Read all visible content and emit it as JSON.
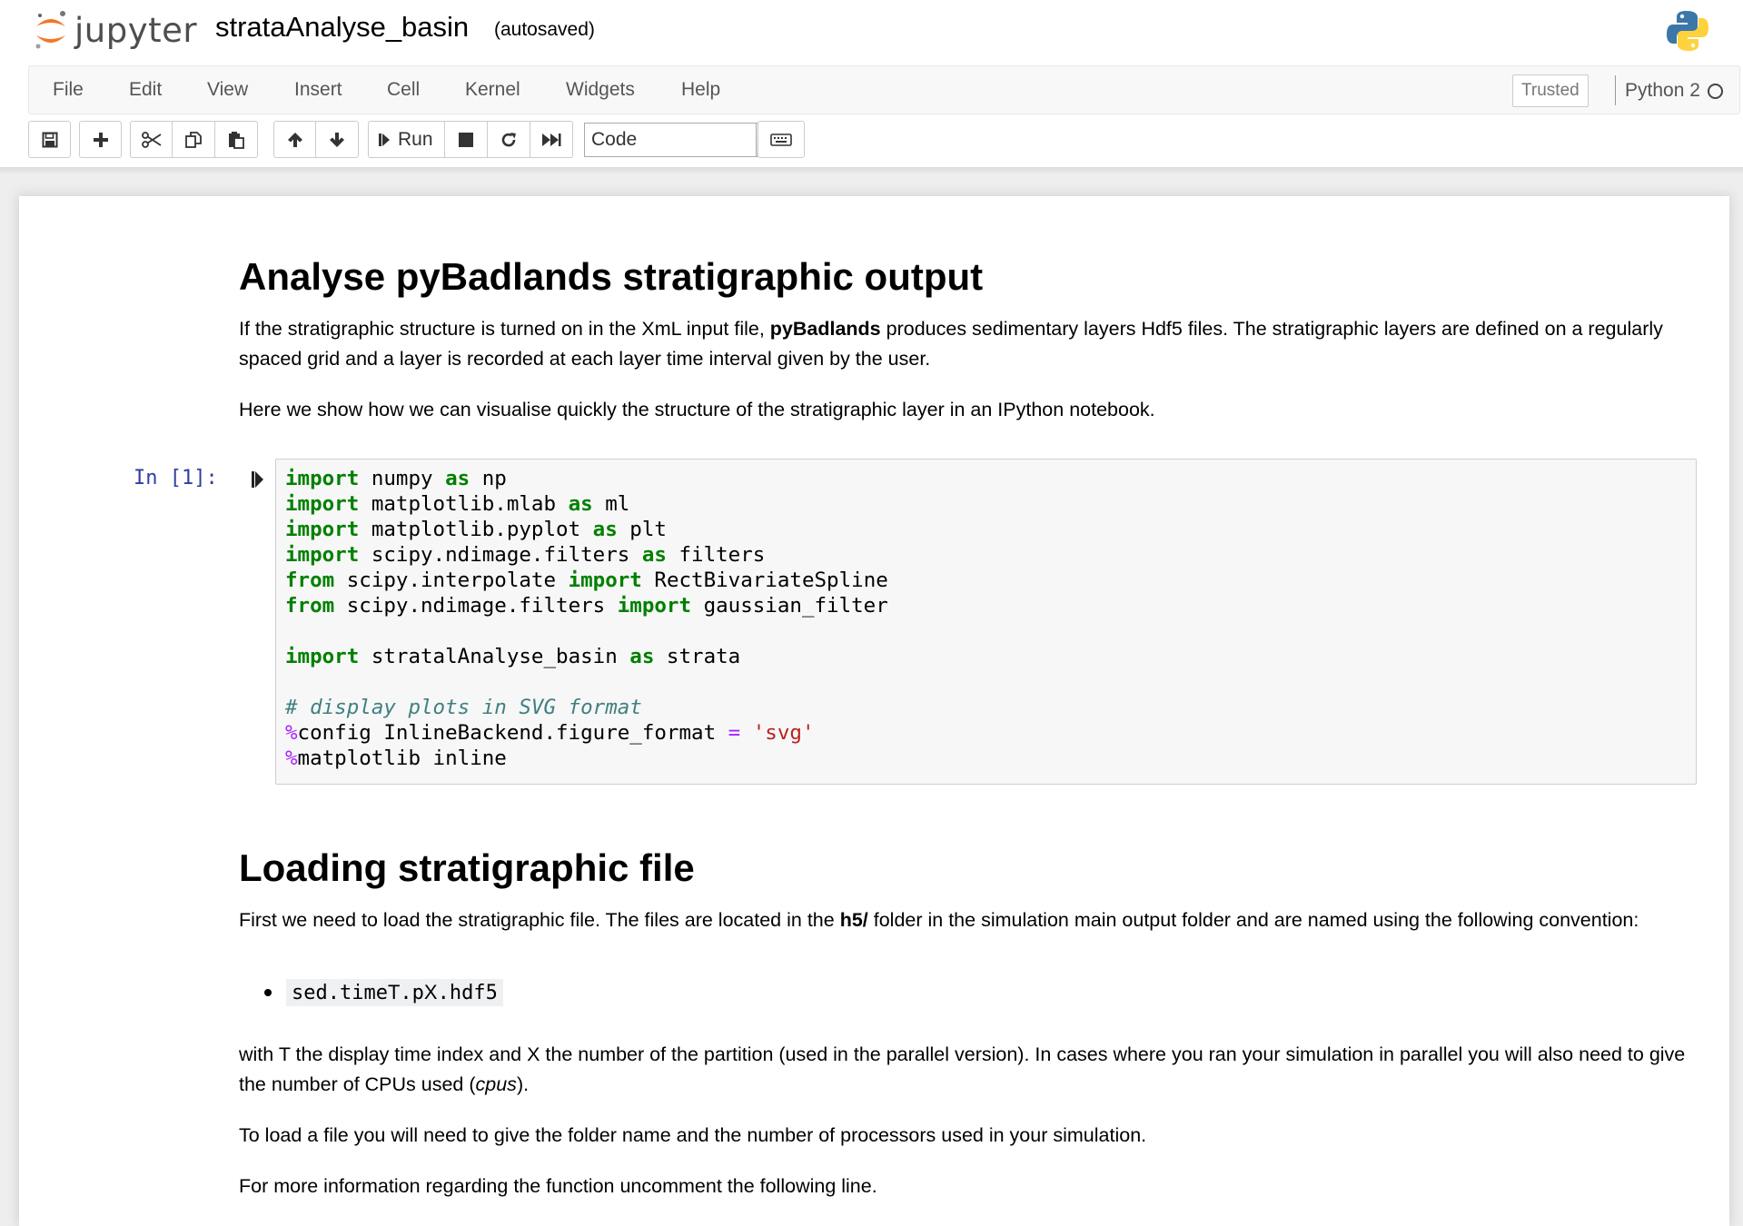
{
  "header": {
    "logo_text": "jupyter",
    "notebook_name": "strataAnalyse_basin",
    "save_status": "(autosaved)"
  },
  "menu": {
    "items": [
      "File",
      "Edit",
      "View",
      "Insert",
      "Cell",
      "Kernel",
      "Widgets",
      "Help"
    ],
    "trusted": "Trusted",
    "kernel": "Python 2"
  },
  "toolbar": {
    "run_label": "Run",
    "cell_type": "Code"
  },
  "cells": {
    "md1": {
      "heading": "Analyse pyBadlands stratigraphic output",
      "p1_before": "If the stratigraphic structure is turned on in the XmL input file, ",
      "p1_bold": "pyBadlands",
      "p1_after": " produces sedimentary layers Hdf5 files. The stratigraphic layers are defined on a regularly spaced grid and a layer is recorded at each layer time interval given by the user.",
      "p2": "Here we show how we can visualise quickly the structure of the stratigraphic layer in an IPython notebook."
    },
    "code1": {
      "prompt": "In [1]:",
      "lines": [
        [
          [
            "kw",
            "import"
          ],
          [
            "",
            " numpy "
          ],
          [
            "kw",
            "as"
          ],
          [
            "",
            " np"
          ]
        ],
        [
          [
            "kw",
            "import"
          ],
          [
            "",
            " matplotlib.mlab "
          ],
          [
            "kw",
            "as"
          ],
          [
            "",
            " ml"
          ]
        ],
        [
          [
            "kw",
            "import"
          ],
          [
            "",
            " matplotlib.pyplot "
          ],
          [
            "kw",
            "as"
          ],
          [
            "",
            " plt"
          ]
        ],
        [
          [
            "kw",
            "import"
          ],
          [
            "",
            " scipy.ndimage.filters "
          ],
          [
            "kw",
            "as"
          ],
          [
            "",
            " filters"
          ]
        ],
        [
          [
            "kw",
            "from"
          ],
          [
            "",
            " scipy.interpolate "
          ],
          [
            "kw",
            "import"
          ],
          [
            "",
            " RectBivariateSpline"
          ]
        ],
        [
          [
            "kw",
            "from"
          ],
          [
            "",
            " scipy.ndimage.filters "
          ],
          [
            "kw",
            "import"
          ],
          [
            "",
            " gaussian_filter"
          ]
        ],
        [],
        [
          [
            "kw",
            "import"
          ],
          [
            "",
            " stratalAnalyse_basin "
          ],
          [
            "kw",
            "as"
          ],
          [
            "",
            " strata"
          ]
        ],
        [],
        [
          [
            "cm",
            "# display plots in SVG format"
          ]
        ],
        [
          [
            "mg",
            "%"
          ],
          [
            "",
            "config InlineBackend.figure_format "
          ],
          [
            "op",
            "="
          ],
          [
            "",
            " "
          ],
          [
            "st",
            "'svg'"
          ]
        ],
        [
          [
            "mg",
            "%"
          ],
          [
            "",
            "matplotlib inline"
          ]
        ]
      ]
    },
    "md2": {
      "heading": "Loading stratigraphic file",
      "p1_before": "First we need to load the stratigraphic file. The files are located in the ",
      "p1_bold": "h5/",
      "p1_after": " folder in the simulation main output folder and are named using the following convention:",
      "bullet_code1": "sed.time",
      "bullet_t": "T",
      "bullet_code2": ".p",
      "bullet_x": "X",
      "bullet_code3": ".hdf5",
      "p2_before": "with T the display time index and X the number of the partition (used in the parallel version). In cases where you ran your simulation in parallel you will also need to give the number of CPUs used (",
      "p2_italic": "cpus",
      "p2_after": ").",
      "p3": "To load a file you will need to give the folder name and the number of processors used in your simulation.",
      "p4": "For more information regarding the function uncomment the following line."
    }
  }
}
